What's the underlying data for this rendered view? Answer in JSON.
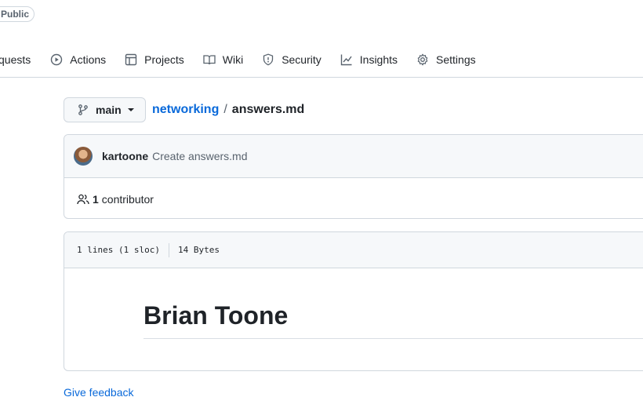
{
  "header": {
    "visibility_badge": "Public"
  },
  "nav": {
    "items": [
      {
        "label": "quests",
        "icon": "pull-request-icon"
      },
      {
        "label": "Actions",
        "icon": "play-icon"
      },
      {
        "label": "Projects",
        "icon": "table-icon"
      },
      {
        "label": "Wiki",
        "icon": "book-icon"
      },
      {
        "label": "Security",
        "icon": "shield-icon"
      },
      {
        "label": "Insights",
        "icon": "graph-icon"
      },
      {
        "label": "Settings",
        "icon": "gear-icon"
      }
    ]
  },
  "branch": {
    "name": "main"
  },
  "breadcrumb": {
    "repo": "networking",
    "separator": "/",
    "file": "answers.md"
  },
  "commit": {
    "author": "kartoone",
    "message": "Create answers.md"
  },
  "contributors": {
    "count": "1",
    "label": "contributor"
  },
  "file": {
    "lines": "1 lines (1 sloc)",
    "size": "14 Bytes"
  },
  "content": {
    "heading": "Brian Toone"
  },
  "footer": {
    "feedback": "Give feedback"
  },
  "colors": {
    "link": "#0969da",
    "border": "#d0d7de",
    "subtle_bg": "#f6f8fa"
  }
}
